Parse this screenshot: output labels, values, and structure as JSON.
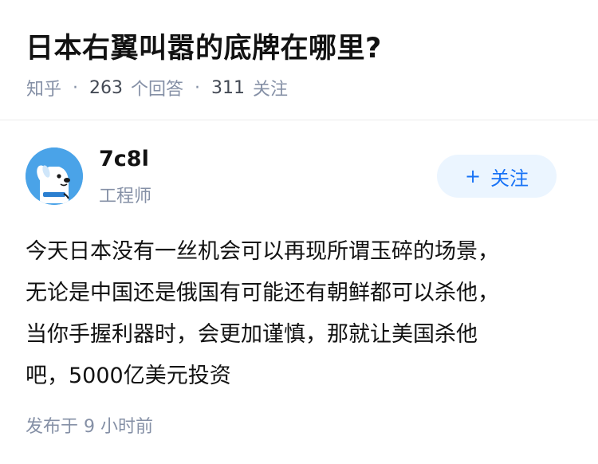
{
  "question": {
    "title": "日本右翼叫嚣的底牌在哪里?",
    "source": "知乎",
    "answer_count": "263",
    "answer_label": "个回答",
    "follower_count": "311",
    "follower_label": "关注"
  },
  "author": {
    "name": "7c8l",
    "title": "工程师",
    "avatar_icon": "cartoon-dog-avatar-icon",
    "follow_label": "关注",
    "follow_icon": "plus-icon"
  },
  "answer": {
    "lines": [
      "今天日本没有一丝机会可以再现所谓玉碎的场景，",
      "无论是中国还是俄国有可能还有朝鲜都可以杀他，",
      "当你手握利器时，会更加谨慎，那就让美国杀他",
      "吧，5000亿美元投资"
    ],
    "posted_time": "发布于 9 小时前"
  },
  "colors": {
    "accent": "#1772f6",
    "follow_bg": "#ebf5ff",
    "meta_gray": "#8590a6",
    "avatar_bg": "#4aa3e8"
  }
}
